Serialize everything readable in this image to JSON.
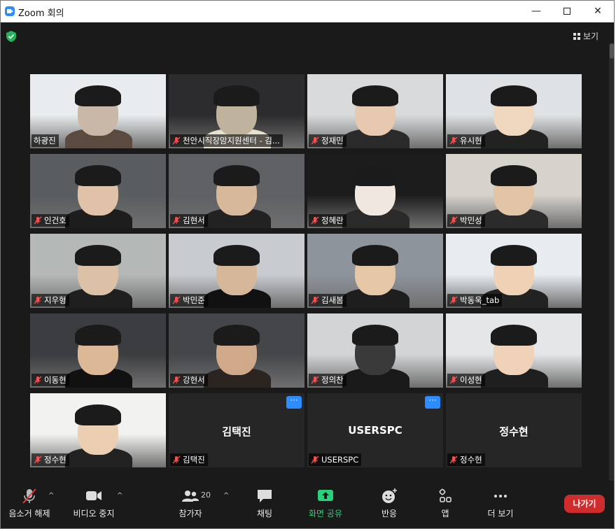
{
  "window": {
    "title": "Zoom 회의",
    "min": "—",
    "close": "✕"
  },
  "header": {
    "view_label": "보기"
  },
  "tiles": [
    {
      "name": "하광진",
      "mic_muted": false,
      "active": true
    },
    {
      "name": "천안시직장맘지원센터 - 김...",
      "mic_muted": true
    },
    {
      "name": "정재민",
      "mic_muted": true
    },
    {
      "name": "유시현",
      "mic_muted": true
    },
    {
      "name": "인건호",
      "mic_muted": true
    },
    {
      "name": "김현서",
      "mic_muted": true
    },
    {
      "name": "정혜란",
      "mic_muted": true
    },
    {
      "name": "박민성",
      "mic_muted": true
    },
    {
      "name": "지우형",
      "mic_muted": true
    },
    {
      "name": "박민준",
      "mic_muted": true
    },
    {
      "name": "김새봄",
      "mic_muted": true
    },
    {
      "name": "박동욱_tab",
      "mic_muted": true
    },
    {
      "name": "이동현",
      "mic_muted": true
    },
    {
      "name": "강현서",
      "mic_muted": true
    },
    {
      "name": "정의찬",
      "mic_muted": true
    },
    {
      "name": "이성현",
      "mic_muted": true
    },
    {
      "name": "정수현",
      "mic_muted": true
    },
    {
      "name": "김택진",
      "mic_muted": true,
      "video_off": true,
      "display_name": "김택진"
    },
    {
      "name": "USERSPC",
      "mic_muted": true,
      "video_off": true,
      "display_name": "USERSPC"
    },
    {
      "name": "정수현",
      "mic_muted": true,
      "video_off": true,
      "display_name": "정수현"
    }
  ],
  "tile_more": "···",
  "toolbar": {
    "unmute": "음소거 해제",
    "video": "비디오 중지",
    "participants": "참가자",
    "participants_count": "20",
    "chat": "채팅",
    "share": "화면 공유",
    "reactions": "반응",
    "apps": "앱",
    "more": "더 보기",
    "caret": "^",
    "leave": "나가기"
  },
  "colors": {
    "accent": "#2d8cff",
    "share_green": "#29d17a",
    "leave_red": "#cf2d2d",
    "active_border": "#e9e75a"
  }
}
